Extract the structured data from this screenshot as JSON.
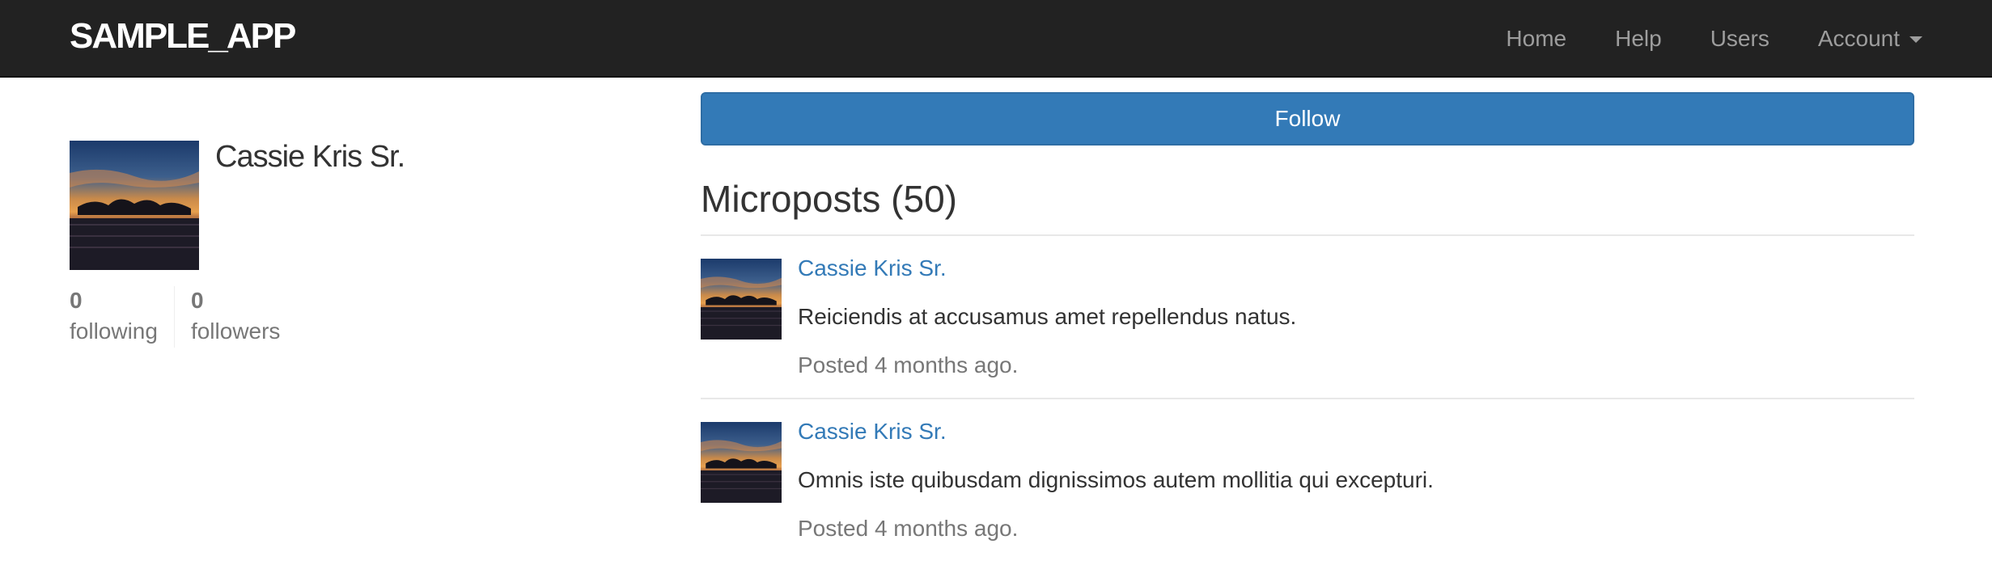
{
  "navbar": {
    "brand": "sample_app",
    "links": {
      "home": "Home",
      "help": "Help",
      "users": "Users",
      "account": "Account"
    }
  },
  "profile": {
    "name": "Cassie Kris Sr.",
    "following_count": "0",
    "following_label": "following",
    "followers_count": "0",
    "followers_label": "followers"
  },
  "follow_button_label": "Follow",
  "microposts": {
    "title": "Microposts (50)",
    "items": [
      {
        "user": "Cassie Kris Sr.",
        "content": "Reiciendis at accusamus amet repellendus natus.",
        "timestamp": "Posted 4 months ago."
      },
      {
        "user": "Cassie Kris Sr.",
        "content": "Omnis iste quibusdam dignissimos autem mollitia qui excepturi.",
        "timestamp": "Posted 4 months ago."
      }
    ]
  },
  "colors": {
    "navbar_bg": "#222222",
    "brand": "#ffffff",
    "nav_link": "#9d9d9d",
    "primary": "#337ab7",
    "muted": "#777777"
  }
}
